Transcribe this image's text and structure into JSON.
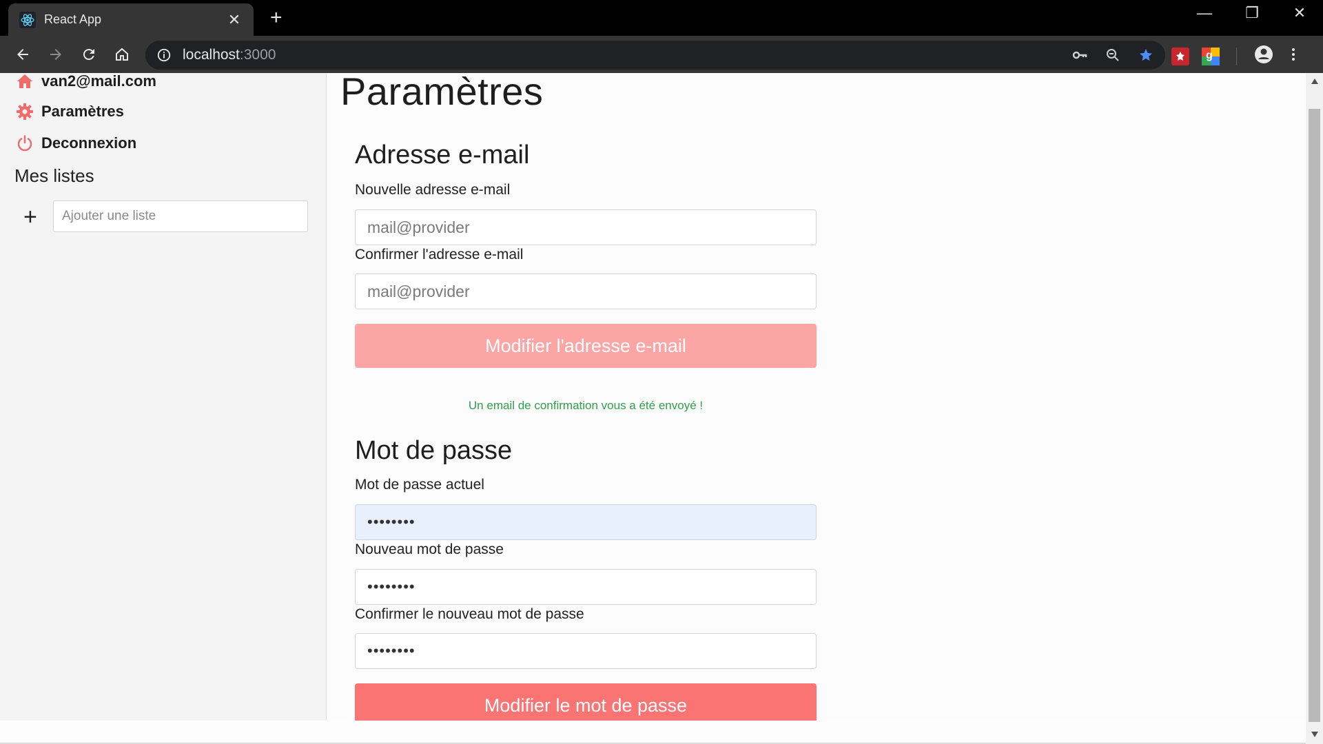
{
  "browser": {
    "tab_title": "React App",
    "url_host": "localhost",
    "url_port": ":3000",
    "icons": [
      "react-icon",
      "close-icon",
      "plus-icon",
      "minimize-icon",
      "restore-icon",
      "window-close-icon",
      "back-icon",
      "forward-icon",
      "reload-icon",
      "home-icon",
      "info-icon",
      "key-icon",
      "zoom-icon",
      "star-icon",
      "extension-icon",
      "translate-icon",
      "account-icon",
      "menu-icon"
    ]
  },
  "sidebar": {
    "user_email": "van2@mail.com",
    "settings_label": "Paramètres",
    "logout_label": "Deconnexion",
    "lists_heading": "Mes listes",
    "add_list_placeholder": "Ajouter une liste",
    "add_list_button": "+"
  },
  "main": {
    "page_title": "Paramètres",
    "email_section": {
      "title": "Adresse e-mail",
      "new_label": "Nouvelle adresse e-mail",
      "new_placeholder": "mail@provider",
      "confirm_label": "Confirmer l'adresse e-mail",
      "confirm_placeholder": "mail@provider",
      "submit_label": "Modifier l'adresse e-mail",
      "success_message": "Un email de confirmation vous a été envoyé !"
    },
    "password_section": {
      "title": "Mot de passe",
      "current_label": "Mot de passe actuel",
      "current_value": "••••••••",
      "new_label": "Nouveau mot de passe",
      "new_value": "••••••••",
      "confirm_label": "Confirmer le nouveau mot de passe",
      "confirm_value": "••••••••",
      "submit_label": "Modifier le mot de passe"
    }
  },
  "colors": {
    "accent": "#fb7474",
    "accent_disabled": "#fca5a5",
    "success": "#2fa04a",
    "icon_red": "#f26b6b"
  }
}
